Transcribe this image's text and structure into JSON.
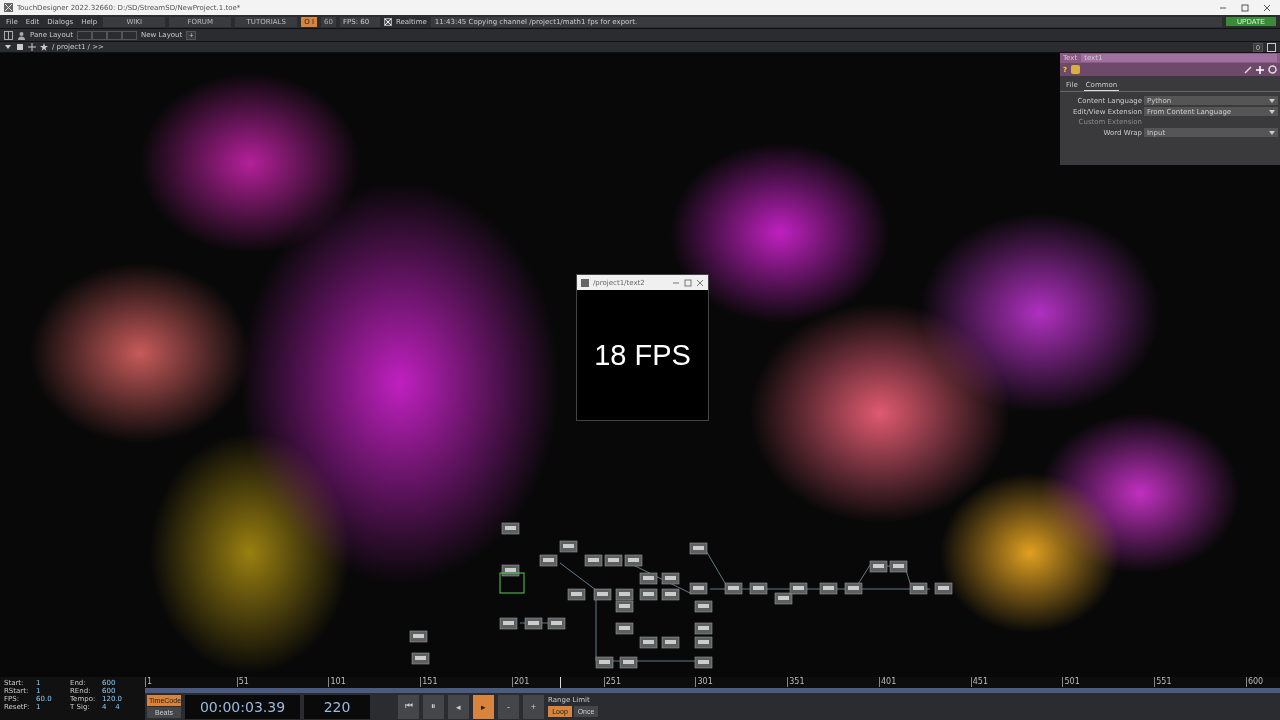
{
  "window": {
    "title": "TouchDesigner 2022.32660: D:/SD/StreamSD/NewProject.1.toe*"
  },
  "menu": [
    "File",
    "Edit",
    "Dialogs",
    "Help"
  ],
  "links": [
    "WIKI",
    "FORUM",
    "TUTORIALS"
  ],
  "toggles": [
    {
      "label": "O I",
      "on": true
    },
    {
      "label": "60",
      "on": false
    }
  ],
  "fps": {
    "label": "FPS:",
    "value": "60"
  },
  "realtime": {
    "label": "Realtime",
    "checked": true
  },
  "status_message": "11:43:45 Copying channel /project1/math1 fps for export.",
  "update_button": "UPDATE",
  "layout_bar": {
    "pane_layout": "Pane Layout",
    "new_layout": "New Layout",
    "add": "+"
  },
  "path_bar": {
    "path": "/ project1 / >>",
    "zoom_button": "0"
  },
  "param_panel": {
    "type": "Text",
    "name": "text1",
    "help": "?",
    "tabs": [
      {
        "label": "File",
        "selected": false
      },
      {
        "label": "Common",
        "selected": true
      }
    ],
    "params": [
      {
        "label": "Content Language",
        "value": "Python",
        "disabled": false
      },
      {
        "label": "Edit/View Extension",
        "value": "From Content Language",
        "disabled": false
      },
      {
        "label": "Custom Extension",
        "disabled": true
      },
      {
        "label": "Word Wrap",
        "value": "Input",
        "disabled": false
      }
    ]
  },
  "viewer": {
    "title": "/project1/text2",
    "text": "18 FPS"
  },
  "timeline": {
    "info": [
      {
        "label": "Start:",
        "value": "1"
      },
      {
        "label": "End:",
        "value": "600"
      },
      {
        "label": "RStart:",
        "value": "1"
      },
      {
        "label": "REnd:",
        "value": "600"
      },
      {
        "label": "FPS:",
        "value": "60.0"
      },
      {
        "label": "Tempo:",
        "value": "120.0"
      },
      {
        "label": "ResetF:",
        "value": "1"
      },
      {
        "label": "T Sig:",
        "value": "4    4"
      }
    ],
    "ticks": [
      "1",
      "51",
      "101",
      "151",
      "201",
      "251",
      "301",
      "351",
      "401",
      "451",
      "501",
      "551",
      "600"
    ],
    "playhead": {
      "level": 0.366
    },
    "modes": [
      {
        "label": "TimeCode",
        "selected": true
      },
      {
        "label": "Beats",
        "selected": false
      }
    ],
    "timecode": "00:00:03.39",
    "frame": "220",
    "transport": [
      {
        "label": "⏮",
        "selected": false
      },
      {
        "label": "⏸",
        "selected": false
      },
      {
        "label": "◂",
        "selected": false
      },
      {
        "label": "▸",
        "selected": true
      },
      {
        "label": "-",
        "selected": false
      },
      {
        "label": "+",
        "selected": false
      }
    ],
    "range_limit": {
      "label": "Range Limit",
      "options": [
        {
          "label": "Loop",
          "selected": true
        },
        {
          "label": "Once",
          "selected": false
        }
      ]
    }
  }
}
